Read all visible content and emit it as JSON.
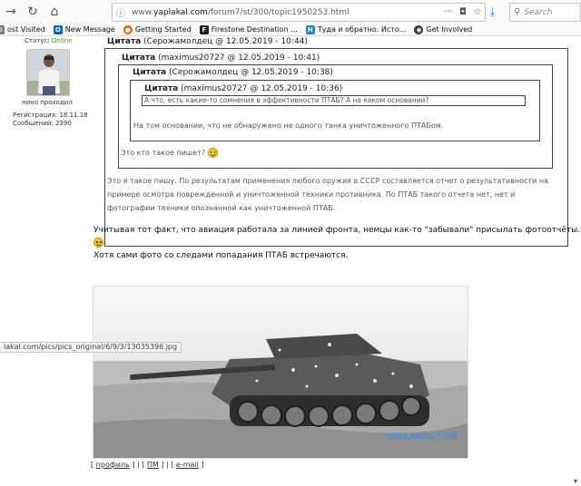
{
  "browser": {
    "back_glyph": "→",
    "reload_glyph": "↻",
    "home_glyph": "⌂",
    "url_prefix": "www.",
    "url_domain": "yaplakal.com",
    "url_path": "/forum7/st/300/topic1950253.html",
    "search_placeholder": "Search",
    "bookmarks": [
      {
        "label": "ost Visited",
        "icon": "gear-icon",
        "color": "#7a7a7a",
        "glyph": "⚙"
      },
      {
        "label": "New Message",
        "icon": "outlook-icon",
        "color": "#0a64b4",
        "glyph": "O"
      },
      {
        "label": "Getting Started",
        "icon": "firefox-icon",
        "color": "#e66000",
        "glyph": "●"
      },
      {
        "label": "Firestone Destination ...",
        "icon": "firestone-icon",
        "color": "#222222",
        "glyph": "F"
      },
      {
        "label": "Туда и обратно. Исто...",
        "icon": "h-icon",
        "color": "#2a7fc9",
        "glyph": "H"
      },
      {
        "label": "Get Involved",
        "icon": "globe-icon",
        "color": "#333333",
        "glyph": "◉"
      }
    ]
  },
  "user": {
    "status_label": "Статус:",
    "status_value": "Online",
    "username": "нино проходил",
    "registration_label": "Регистрация:",
    "registration_value": "18.11.18",
    "posts_label": "Сообщений:",
    "posts_value": "2390"
  },
  "quotes": {
    "q1_label": "Цитата",
    "q1_meta": "(Серожамолдец @ 12.05.2019 - 10:44)",
    "q2_label": "Цитата",
    "q2_meta": "(maximus20727 @ 12.05.2019 - 10:41)",
    "q3_label": "Цитата",
    "q3_meta": "(Серожамолдец @ 12.05.2019 - 10:38)",
    "q4_label": "Цитата",
    "q4_meta": "(maximus20727 @ 12.05.2019 - 10:36)",
    "q4_text": "А что, есть какие-то сомнения в эффективности ПТАБ? А на каком основании?",
    "q3_text": "На том основании, что не обнаружено не одного танка уничтоженного ПТАБом.",
    "q2_text": "Это кто такое пишет?",
    "q1_text": "Это я такое пишу. По результатам применения любого оружия в СССР составляется отчет о результативности на примере осмотра поврежденной и уничтоженной техники противника. По ПТАБ такого отчета нет, нет и фотографии техники опознанной как уничтоженной ПТАБ."
  },
  "post": {
    "line1": "Учитывая тот факт, что авиация работала за линией фронта, немцы как-то \"забывали\" присылать фотоотчёты.",
    "line2": "Хотя сами фото со следами попадания ПТАБ встречаются.",
    "watermark": "YAPLAKAL.COM",
    "link_status": "lakal.com/pics/pics_original/6/9/3/13035396.jpg",
    "links": {
      "open": "[",
      "profile": "профиль",
      "sep1": "] | [",
      "pm": "ПМ",
      "sep2": "] | [",
      "email": "e-mail",
      "close": "]"
    }
  }
}
